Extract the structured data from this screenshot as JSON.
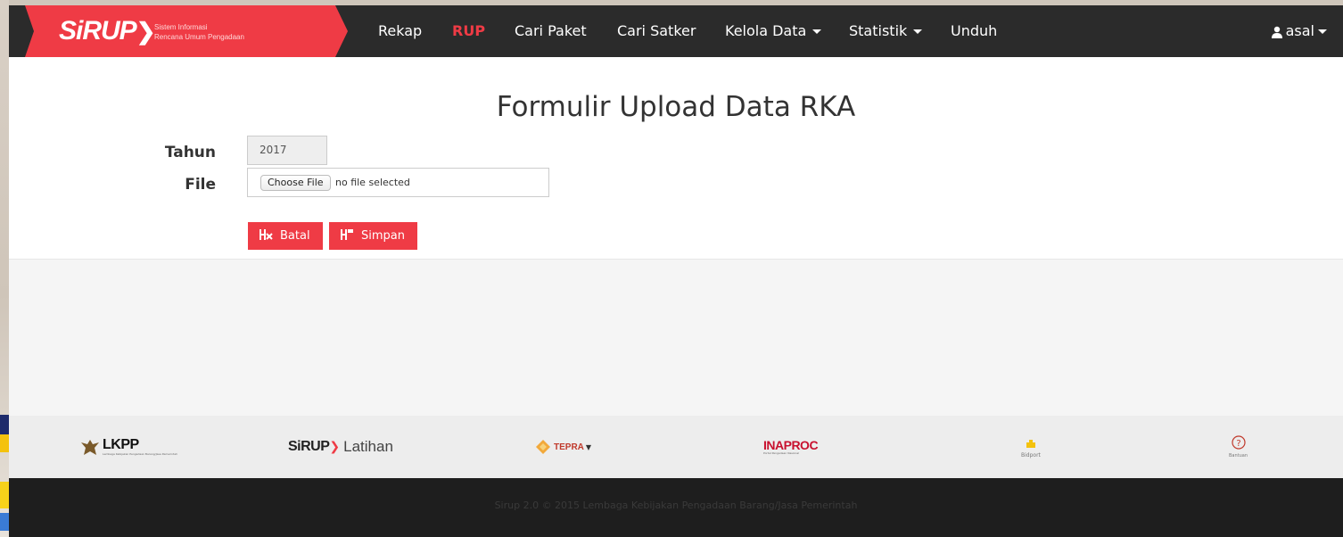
{
  "brand": {
    "logo_text": "SiRUP",
    "subtitle_line1": "Sistem Informasi",
    "subtitle_line2": "Rencana Umum Pengadaan"
  },
  "nav": {
    "items": [
      {
        "label": "Rekap",
        "active": false,
        "dropdown": false
      },
      {
        "label": "RUP",
        "active": true,
        "dropdown": false
      },
      {
        "label": "Cari Paket",
        "active": false,
        "dropdown": false
      },
      {
        "label": "Cari Satker",
        "active": false,
        "dropdown": false
      },
      {
        "label": "Kelola Data",
        "active": false,
        "dropdown": true
      },
      {
        "label": "Statistik",
        "active": false,
        "dropdown": true
      },
      {
        "label": "Unduh",
        "active": false,
        "dropdown": false
      }
    ],
    "user": "asal"
  },
  "form": {
    "title": "Formulir Upload Data RKA",
    "tahun_label": "Tahun",
    "tahun_value": "2017",
    "file_label": "File",
    "choose_file_label": "Choose File",
    "no_file_text": "no file selected",
    "batal_label": "Batal",
    "simpan_label": "Simpan"
  },
  "footer_logos": {
    "lkpp": "LKPP",
    "lkpp_sub": "Lembaga Kebijakan Pengadaan Barang/Jasa Pemerintah",
    "sirup_latihan_brand": "SiRUP",
    "sirup_latihan_text": "Latihan",
    "tepra": "TEPRA",
    "inaproc": "INAPROC",
    "inaproc_sub": "Portal Pengadaan Nasional",
    "bidport": "Bidport",
    "bantuan": "Bantuan"
  },
  "footer": {
    "copyright": "Sirup 2.0 © 2015 Lembaga Kebijakan Pengadaan Barang/Jasa Pemerintah"
  },
  "colors": {
    "brand_red": "#ef3b45",
    "navbar_bg": "#2b2b2b",
    "footer_bg": "#1e1e1e"
  }
}
